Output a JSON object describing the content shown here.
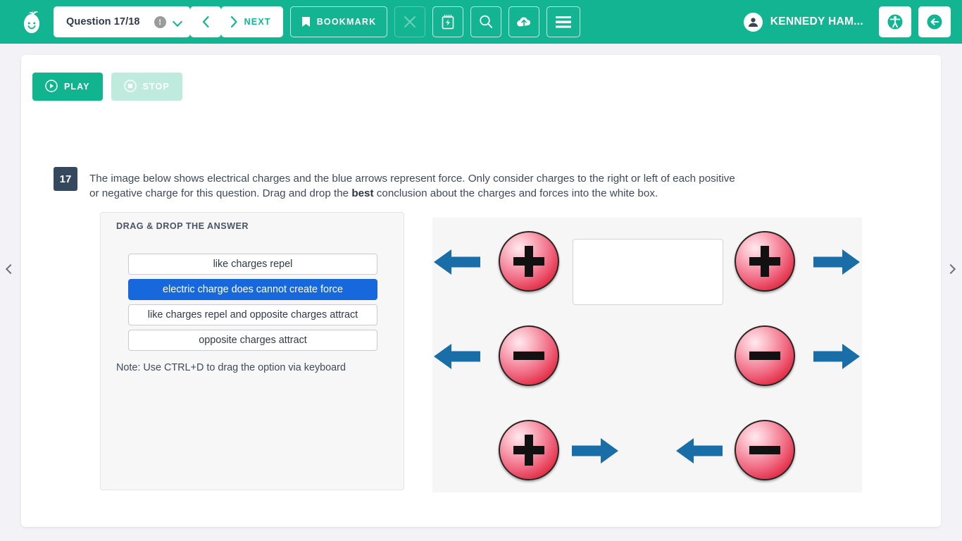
{
  "header": {
    "logo_icon": "pear-smiley-logo",
    "question_label": "Question 17/18",
    "alert_icon": "exclamation-circle-icon",
    "dropdown_icon": "chevron-down-icon",
    "prev_icon": "chevron-left-icon",
    "next_icon": "chevron-right-icon",
    "next_label": "NEXT",
    "bookmark_icon": "bookmark-icon",
    "bookmark_label": "BOOKMARK",
    "close_icon": "close-x-icon",
    "notes_icon": "notepad-icon",
    "search_icon": "magnifier-icon",
    "upload_icon": "cloud-upload-icon",
    "menu_icon": "hamburger-menu-icon",
    "user_name": "KENNEDY HAM...",
    "avatar_icon": "user-avatar-icon",
    "accessibility_icon": "accessibility-person-icon",
    "logout_icon": "logout-arrow-icon",
    "bg_color": "#13b491"
  },
  "side_nav": {
    "prev_icon": "chevron-left-icon",
    "next_icon": "chevron-right-icon"
  },
  "media": {
    "play_label": "PLAY",
    "play_icon": "play-circle-icon",
    "stop_label": "STOP",
    "stop_icon": "stop-circle-icon"
  },
  "question": {
    "number": "17",
    "text_part1": "The image below shows electrical charges and the blue arrows represent force. Only consider charges to the right or left of each positive or negative charge for this question. Drag and drop the ",
    "emphasis": "best",
    "text_part2": " conclusion about the charges and forces into the white box."
  },
  "drag_drop": {
    "title": "DRAG & DROP THE ANSWER",
    "options": [
      {
        "label": "like charges repel",
        "selected": false
      },
      {
        "label": "electric charge does cannot create force",
        "selected": true
      },
      {
        "label": "like charges repel and opposite charges attract",
        "selected": false
      },
      {
        "label": "opposite charges attract",
        "selected": false
      }
    ],
    "note": "Note: Use CTRL+D to drag the option via keyboard",
    "selected_color": "#1668dc"
  },
  "diagram": {
    "arrow_color": "#1a6ea8",
    "charge_color": "#e0273f",
    "drop_target_name": "answer-drop-box",
    "rows": [
      {
        "left": {
          "arrow": "left",
          "charge": "plus"
        },
        "right": {
          "charge": "plus",
          "arrow": "right"
        }
      },
      {
        "left": {
          "arrow": "left",
          "charge": "minus"
        },
        "right": {
          "charge": "minus",
          "arrow": "right"
        }
      },
      {
        "left": {
          "charge": "plus",
          "arrow": "right"
        },
        "right": {
          "arrow": "left",
          "charge": "minus"
        }
      }
    ]
  }
}
